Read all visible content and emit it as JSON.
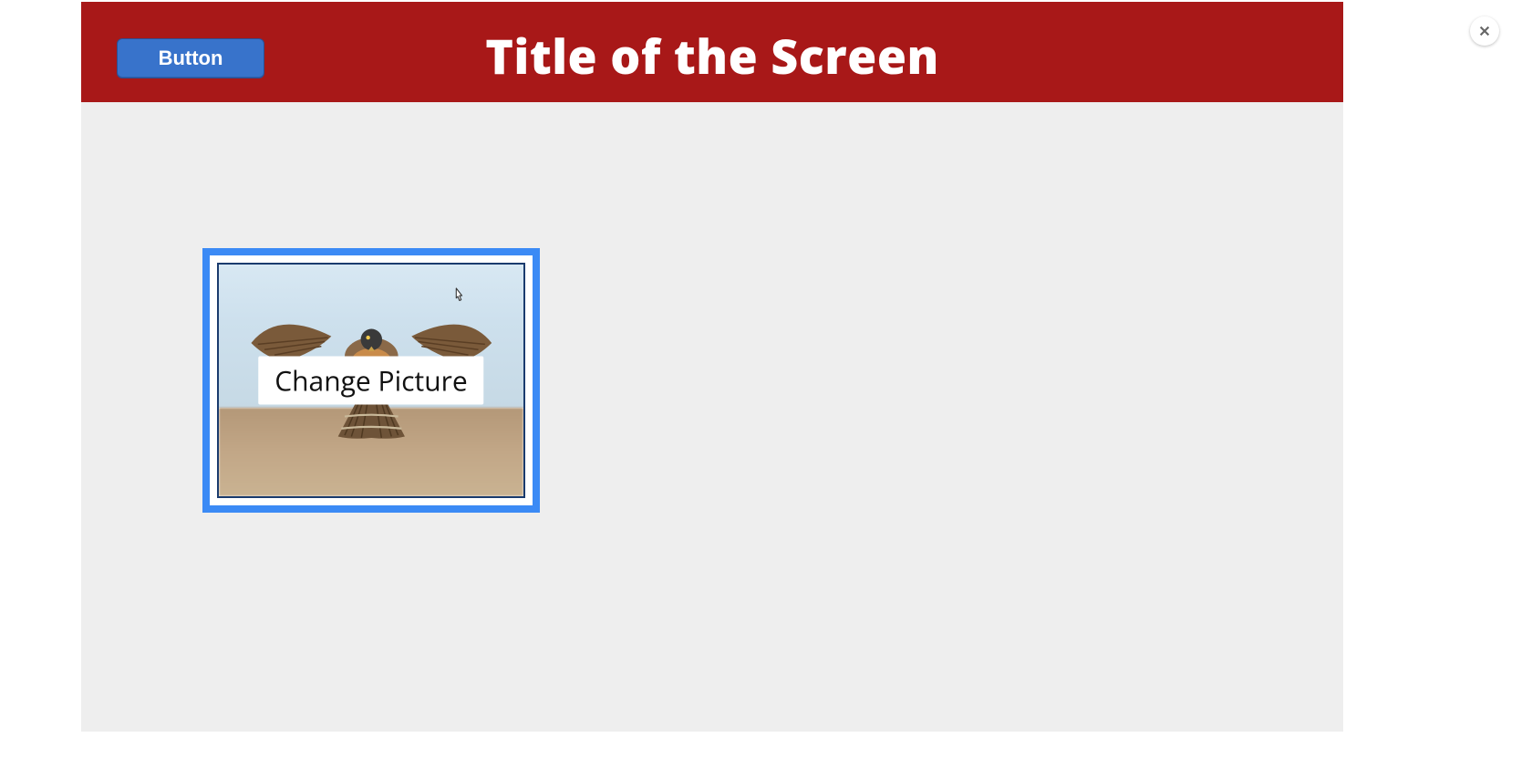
{
  "header": {
    "button_label": "Button",
    "title": "Title of the Screen"
  },
  "image_card": {
    "overlay_label": "Change Picture",
    "subject": "falcon-in-flight",
    "selected": true
  },
  "colors": {
    "header_bg": "#a81818",
    "primary_button_bg": "#3873cb",
    "selection_border": "#3b8af5",
    "canvas_bg": "#eeeeee"
  }
}
